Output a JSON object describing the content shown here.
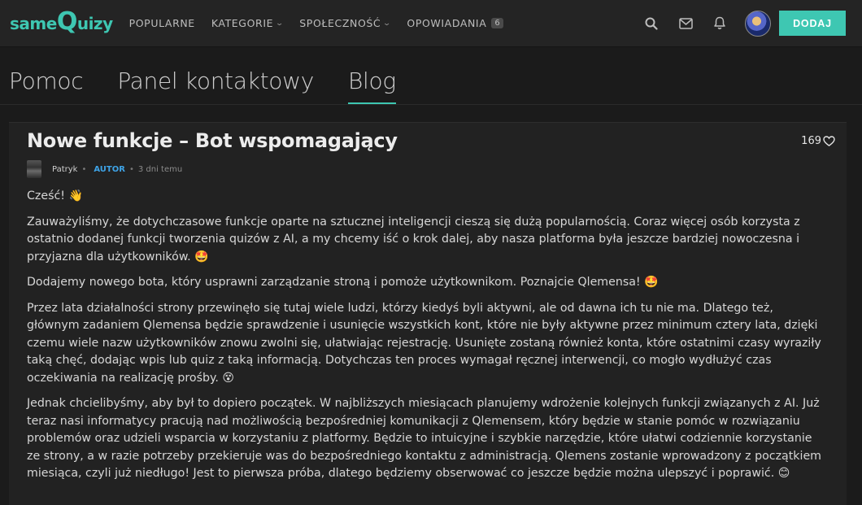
{
  "header": {
    "logo": {
      "part1": "same",
      "part2": "Q",
      "part3": "uizy"
    },
    "nav": [
      {
        "label": "POPULARNE",
        "dropdown": false
      },
      {
        "label": "KATEGORIE",
        "dropdown": true
      },
      {
        "label": "SPOŁECZNOŚĆ",
        "dropdown": true
      },
      {
        "label": "OPOWIADANIA",
        "dropdown": false,
        "badge": "6"
      }
    ],
    "add_label": "DODAJ",
    "accent_color": "#3ec7b2"
  },
  "tabs": [
    {
      "label": "Pomoc"
    },
    {
      "label": "Panel kontaktowy"
    },
    {
      "label": "Blog",
      "active": true
    }
  ],
  "post": {
    "title": "Nowe funkcje – Bot wspomagający",
    "likes": "169",
    "author": "Patryk",
    "author_badge": "AUTOR",
    "date": "3 dni temu",
    "paragraphs": [
      {
        "text": "Cześć! ",
        "emoji": "👋"
      },
      {
        "text": "Zauważyliśmy, że dotychczasowe funkcje oparte na sztucznej inteligencji cieszą się dużą popularnością. Coraz więcej osób korzysta z ostatnio dodanej funkcji tworzenia quizów z AI, a my chcemy iść o krok dalej, aby nasza platforma była jeszcze bardziej nowoczesna i przyjazna dla użytkowników. ",
        "emoji": "🤩"
      },
      {
        "text": "Dodajemy nowego bota, który usprawni zarządzanie stroną i pomoże użytkownikom. Poznajcie Qlemensa! ",
        "emoji": "🤩"
      },
      {
        "text": "Przez lata działalności strony przewinęło się tutaj wiele ludzi, którzy kiedyś byli aktywni, ale od dawna ich tu nie ma. Dlatego też, głównym zadaniem Qlemensa będzie sprawdzenie i usunięcie wszystkich kont, które nie były aktywne przez minimum cztery lata, dzięki czemu wiele nazw użytkowników znowu zwolni się, ułatwiając rejestrację. Usunięte zostaną również konta, które ostatnimi czasy wyraziły taką chęć, dodając wpis lub quiz z taką informacją. Dotychczas ten proces wymagał ręcznej interwencji, co mogło wydłużyć czas oczekiwania na realizację prośby. ",
        "emoji": "😵"
      },
      {
        "text": "Jednak chcielibyśmy, aby był to dopiero początek. W najbliższych miesiącach planujemy wdrożenie kolejnych funkcji związanych z AI. Już teraz nasi informatycy pracują nad możliwością bezpośredniej komunikacji z Qlemensem, który będzie w stanie pomóc w rozwiązaniu problemów oraz udzieli wsparcia w korzystaniu z platformy. Będzie to intuicyjne i szybkie narzędzie, które ułatwi codziennie korzystanie ze strony, a w razie potrzeby przekieruje was do bezpośredniego kontaktu z administracją. Qlemens zostanie wprowadzony z początkiem miesiąca, czyli już niedługo! Jest to pierwsza próba, dlatego będziemy obserwować co jeszcze będzie można ulepszyć i poprawić. ",
        "emoji": "😊"
      }
    ]
  }
}
